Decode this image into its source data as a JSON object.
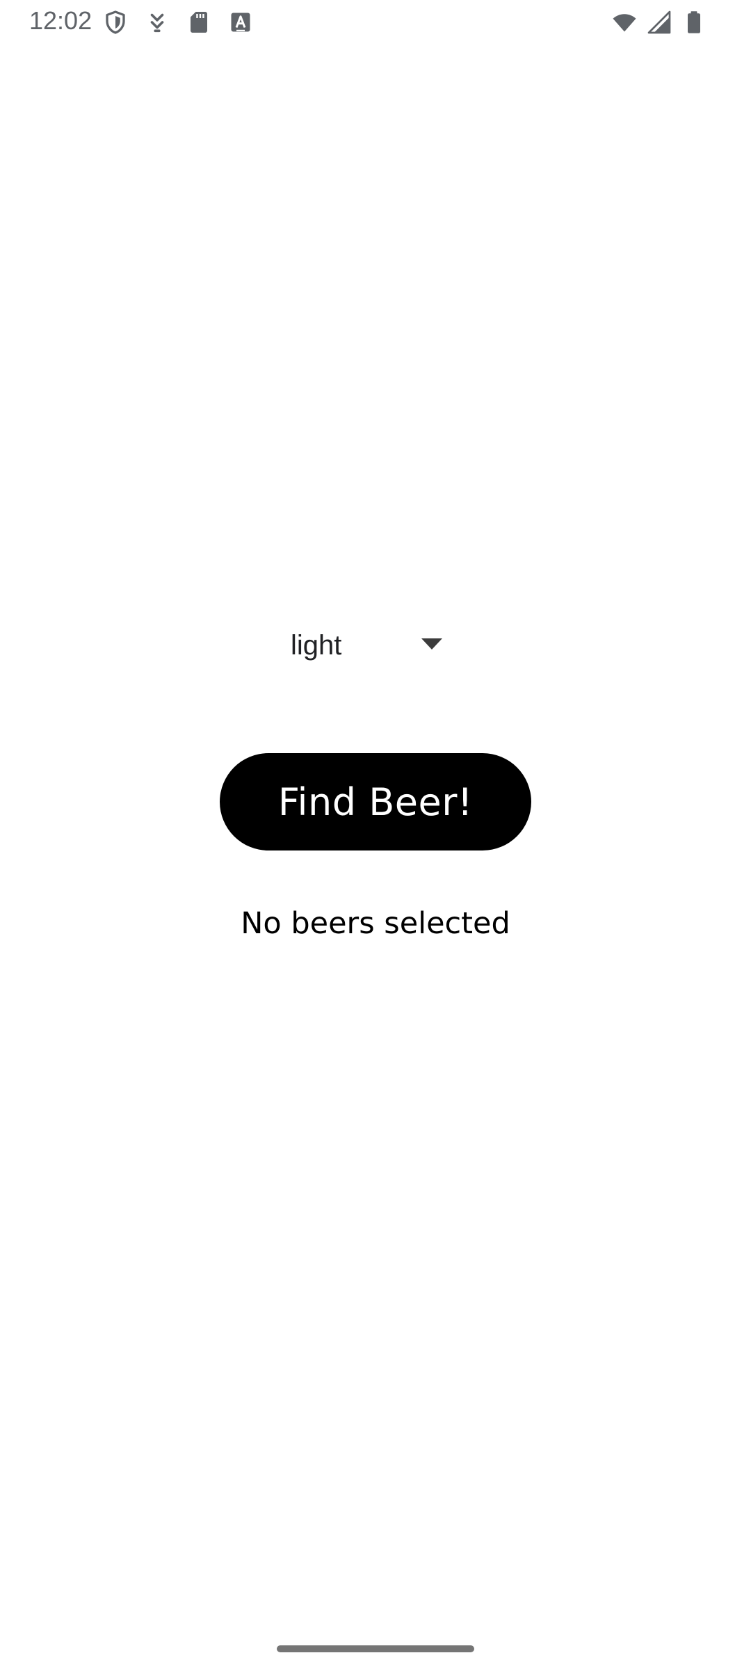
{
  "status_bar": {
    "time": "12:02",
    "left_icons": [
      "shield-icon",
      "download-arrows-icon",
      "sd-card-icon",
      "keyboard-a-icon"
    ],
    "right_icons": [
      "wifi-icon",
      "cellular-signal-icon",
      "battery-icon"
    ],
    "icon_color": "#5f6368"
  },
  "main": {
    "beer_type_dropdown": {
      "selected_value": "light"
    },
    "find_button_label": "Find Beer!",
    "result_text": "No beers selected"
  },
  "colors": {
    "background": "#ffffff",
    "button_background": "#000000",
    "button_text": "#ffffff",
    "nav_handle": "#757575"
  }
}
